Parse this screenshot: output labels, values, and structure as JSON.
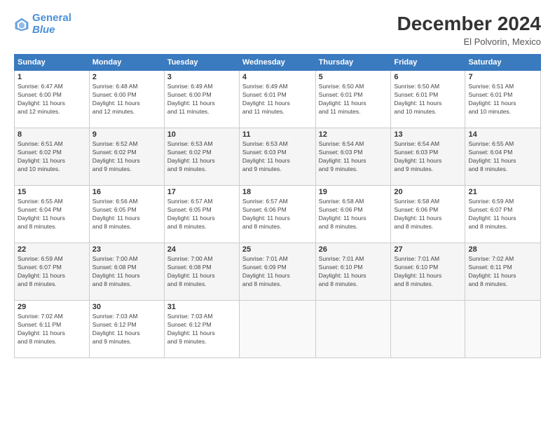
{
  "header": {
    "logo_line1": "General",
    "logo_line2": "Blue",
    "month": "December 2024",
    "location": "El Polvorin, Mexico"
  },
  "columns": [
    "Sunday",
    "Monday",
    "Tuesday",
    "Wednesday",
    "Thursday",
    "Friday",
    "Saturday"
  ],
  "weeks": [
    [
      {
        "day": "1",
        "detail": "Sunrise: 6:47 AM\nSunset: 6:00 PM\nDaylight: 11 hours\nand 12 minutes."
      },
      {
        "day": "2",
        "detail": "Sunrise: 6:48 AM\nSunset: 6:00 PM\nDaylight: 11 hours\nand 12 minutes."
      },
      {
        "day": "3",
        "detail": "Sunrise: 6:49 AM\nSunset: 6:00 PM\nDaylight: 11 hours\nand 11 minutes."
      },
      {
        "day": "4",
        "detail": "Sunrise: 6:49 AM\nSunset: 6:01 PM\nDaylight: 11 hours\nand 11 minutes."
      },
      {
        "day": "5",
        "detail": "Sunrise: 6:50 AM\nSunset: 6:01 PM\nDaylight: 11 hours\nand 11 minutes."
      },
      {
        "day": "6",
        "detail": "Sunrise: 6:50 AM\nSunset: 6:01 PM\nDaylight: 11 hours\nand 10 minutes."
      },
      {
        "day": "7",
        "detail": "Sunrise: 6:51 AM\nSunset: 6:01 PM\nDaylight: 11 hours\nand 10 minutes."
      }
    ],
    [
      {
        "day": "8",
        "detail": "Sunrise: 6:51 AM\nSunset: 6:02 PM\nDaylight: 11 hours\nand 10 minutes."
      },
      {
        "day": "9",
        "detail": "Sunrise: 6:52 AM\nSunset: 6:02 PM\nDaylight: 11 hours\nand 9 minutes."
      },
      {
        "day": "10",
        "detail": "Sunrise: 6:53 AM\nSunset: 6:02 PM\nDaylight: 11 hours\nand 9 minutes."
      },
      {
        "day": "11",
        "detail": "Sunrise: 6:53 AM\nSunset: 6:03 PM\nDaylight: 11 hours\nand 9 minutes."
      },
      {
        "day": "12",
        "detail": "Sunrise: 6:54 AM\nSunset: 6:03 PM\nDaylight: 11 hours\nand 9 minutes."
      },
      {
        "day": "13",
        "detail": "Sunrise: 6:54 AM\nSunset: 6:03 PM\nDaylight: 11 hours\nand 9 minutes."
      },
      {
        "day": "14",
        "detail": "Sunrise: 6:55 AM\nSunset: 6:04 PM\nDaylight: 11 hours\nand 8 minutes."
      }
    ],
    [
      {
        "day": "15",
        "detail": "Sunrise: 6:55 AM\nSunset: 6:04 PM\nDaylight: 11 hours\nand 8 minutes."
      },
      {
        "day": "16",
        "detail": "Sunrise: 6:56 AM\nSunset: 6:05 PM\nDaylight: 11 hours\nand 8 minutes."
      },
      {
        "day": "17",
        "detail": "Sunrise: 6:57 AM\nSunset: 6:05 PM\nDaylight: 11 hours\nand 8 minutes."
      },
      {
        "day": "18",
        "detail": "Sunrise: 6:57 AM\nSunset: 6:06 PM\nDaylight: 11 hours\nand 8 minutes."
      },
      {
        "day": "19",
        "detail": "Sunrise: 6:58 AM\nSunset: 6:06 PM\nDaylight: 11 hours\nand 8 minutes."
      },
      {
        "day": "20",
        "detail": "Sunrise: 6:58 AM\nSunset: 6:06 PM\nDaylight: 11 hours\nand 8 minutes."
      },
      {
        "day": "21",
        "detail": "Sunrise: 6:59 AM\nSunset: 6:07 PM\nDaylight: 11 hours\nand 8 minutes."
      }
    ],
    [
      {
        "day": "22",
        "detail": "Sunrise: 6:59 AM\nSunset: 6:07 PM\nDaylight: 11 hours\nand 8 minutes."
      },
      {
        "day": "23",
        "detail": "Sunrise: 7:00 AM\nSunset: 6:08 PM\nDaylight: 11 hours\nand 8 minutes."
      },
      {
        "day": "24",
        "detail": "Sunrise: 7:00 AM\nSunset: 6:08 PM\nDaylight: 11 hours\nand 8 minutes."
      },
      {
        "day": "25",
        "detail": "Sunrise: 7:01 AM\nSunset: 6:09 PM\nDaylight: 11 hours\nand 8 minutes."
      },
      {
        "day": "26",
        "detail": "Sunrise: 7:01 AM\nSunset: 6:10 PM\nDaylight: 11 hours\nand 8 minutes."
      },
      {
        "day": "27",
        "detail": "Sunrise: 7:01 AM\nSunset: 6:10 PM\nDaylight: 11 hours\nand 8 minutes."
      },
      {
        "day": "28",
        "detail": "Sunrise: 7:02 AM\nSunset: 6:11 PM\nDaylight: 11 hours\nand 8 minutes."
      }
    ],
    [
      {
        "day": "29",
        "detail": "Sunrise: 7:02 AM\nSunset: 6:11 PM\nDaylight: 11 hours\nand 8 minutes."
      },
      {
        "day": "30",
        "detail": "Sunrise: 7:03 AM\nSunset: 6:12 PM\nDaylight: 11 hours\nand 9 minutes."
      },
      {
        "day": "31",
        "detail": "Sunrise: 7:03 AM\nSunset: 6:12 PM\nDaylight: 11 hours\nand 9 minutes."
      },
      {
        "day": "",
        "detail": ""
      },
      {
        "day": "",
        "detail": ""
      },
      {
        "day": "",
        "detail": ""
      },
      {
        "day": "",
        "detail": ""
      }
    ]
  ]
}
